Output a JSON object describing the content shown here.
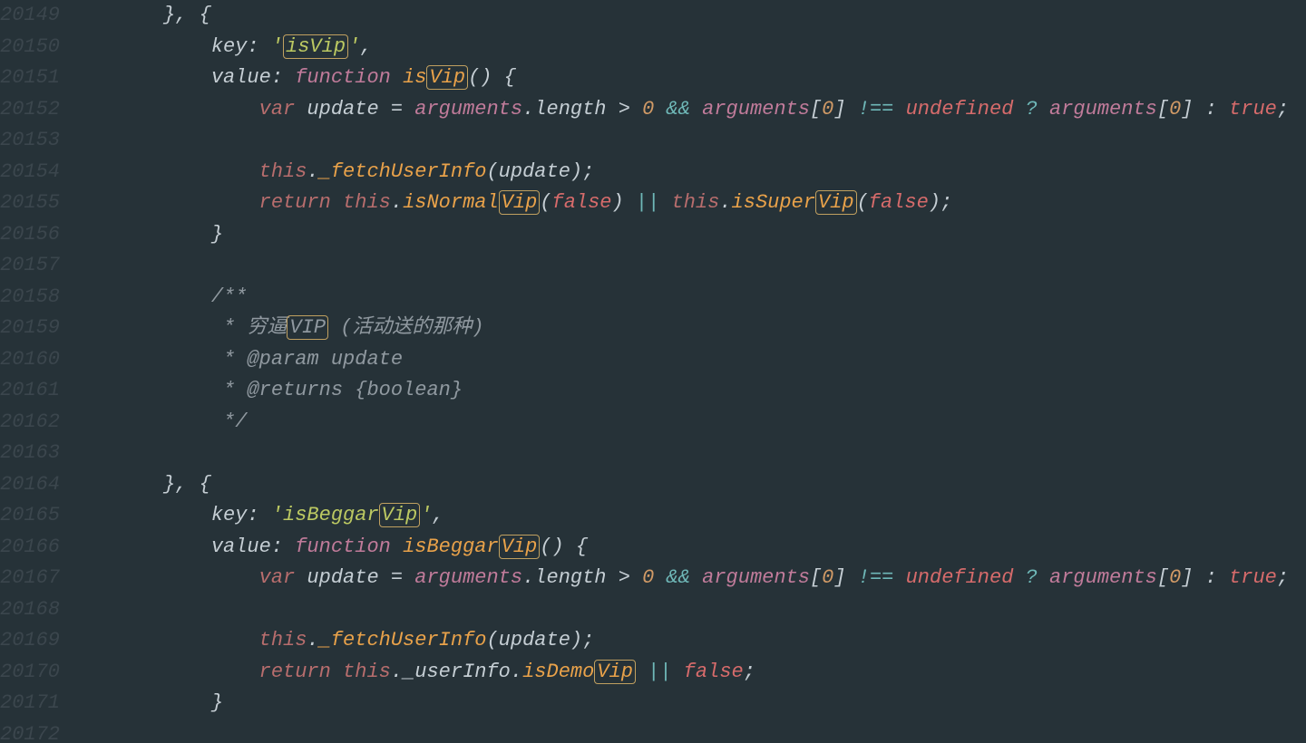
{
  "startLine": 20149,
  "lines": [
    {
      "indent": 0,
      "segs": [
        {
          "t": "}, {",
          "c": ""
        }
      ]
    },
    {
      "indent": 1,
      "segs": [
        {
          "t": "key: ",
          "c": ""
        },
        {
          "t": "'",
          "c": "str"
        },
        {
          "t": "isVip",
          "c": "str box"
        },
        {
          "t": "'",
          "c": "str"
        },
        {
          "t": ",",
          "c": ""
        }
      ]
    },
    {
      "indent": 1,
      "segs": [
        {
          "t": "value: ",
          "c": ""
        },
        {
          "t": "function",
          "c": "ft"
        },
        {
          "t": " ",
          "c": ""
        },
        {
          "t": "is",
          "c": "fn"
        },
        {
          "t": "Vip",
          "c": "fn box"
        },
        {
          "t": "() {",
          "c": ""
        }
      ]
    },
    {
      "indent": 2,
      "segs": [
        {
          "t": "var",
          "c": "kw"
        },
        {
          "t": " update = ",
          "c": ""
        },
        {
          "t": "arguments",
          "c": "arg"
        },
        {
          "t": ".length > ",
          "c": ""
        },
        {
          "t": "0",
          "c": "num"
        },
        {
          "t": " ",
          "c": ""
        },
        {
          "t": "&&",
          "c": "op"
        },
        {
          "t": " ",
          "c": ""
        },
        {
          "t": "arguments",
          "c": "arg"
        },
        {
          "t": "[",
          "c": ""
        },
        {
          "t": "0",
          "c": "num"
        },
        {
          "t": "] ",
          "c": ""
        },
        {
          "t": "!==",
          "c": "op"
        },
        {
          "t": " ",
          "c": ""
        },
        {
          "t": "undefined",
          "c": "bl"
        },
        {
          "t": " ",
          "c": ""
        },
        {
          "t": "?",
          "c": "op"
        },
        {
          "t": " ",
          "c": ""
        },
        {
          "t": "arguments",
          "c": "arg"
        },
        {
          "t": "[",
          "c": ""
        },
        {
          "t": "0",
          "c": "num"
        },
        {
          "t": "] : ",
          "c": ""
        },
        {
          "t": "true",
          "c": "bl"
        },
        {
          "t": ";",
          "c": ""
        }
      ]
    },
    {
      "indent": 2,
      "segs": []
    },
    {
      "indent": 2,
      "segs": [
        {
          "t": "this",
          "c": "kw"
        },
        {
          "t": ".",
          "c": ""
        },
        {
          "t": "_fetchUserInfo",
          "c": "fn"
        },
        {
          "t": "(update);",
          "c": ""
        }
      ]
    },
    {
      "indent": 2,
      "segs": [
        {
          "t": "return",
          "c": "kw"
        },
        {
          "t": " ",
          "c": ""
        },
        {
          "t": "this",
          "c": "kw"
        },
        {
          "t": ".",
          "c": ""
        },
        {
          "t": "isNormal",
          "c": "fn"
        },
        {
          "t": "Vip",
          "c": "fn box"
        },
        {
          "t": "(",
          "c": ""
        },
        {
          "t": "false",
          "c": "bl"
        },
        {
          "t": ") ",
          "c": ""
        },
        {
          "t": "||",
          "c": "op"
        },
        {
          "t": " ",
          "c": ""
        },
        {
          "t": "this",
          "c": "kw"
        },
        {
          "t": ".",
          "c": ""
        },
        {
          "t": "isSuper",
          "c": "fn"
        },
        {
          "t": "Vip",
          "c": "fn box"
        },
        {
          "t": "(",
          "c": ""
        },
        {
          "t": "false",
          "c": "bl"
        },
        {
          "t": ");",
          "c": ""
        }
      ]
    },
    {
      "indent": 1,
      "segs": [
        {
          "t": "}",
          "c": ""
        }
      ]
    },
    {
      "indent": 1,
      "segs": []
    },
    {
      "indent": 1,
      "segs": [
        {
          "t": "/**",
          "c": "com"
        }
      ]
    },
    {
      "indent": 1,
      "segs": [
        {
          "t": " * 穷逼",
          "c": "com"
        },
        {
          "t": "VIP",
          "c": "com box"
        },
        {
          "t": " (活动送的那种)",
          "c": "com"
        }
      ]
    },
    {
      "indent": 1,
      "segs": [
        {
          "t": " * ",
          "c": "com"
        },
        {
          "t": "@param",
          "c": "comi"
        },
        {
          "t": " update",
          "c": "com"
        }
      ]
    },
    {
      "indent": 1,
      "segs": [
        {
          "t": " * ",
          "c": "com"
        },
        {
          "t": "@returns",
          "c": "comi"
        },
        {
          "t": " {boolean}",
          "c": "com"
        }
      ]
    },
    {
      "indent": 1,
      "segs": [
        {
          "t": " */",
          "c": "com"
        }
      ]
    },
    {
      "indent": 1,
      "segs": []
    },
    {
      "indent": 0,
      "segs": [
        {
          "t": "}, {",
          "c": ""
        }
      ]
    },
    {
      "indent": 1,
      "segs": [
        {
          "t": "key: ",
          "c": ""
        },
        {
          "t": "'",
          "c": "str"
        },
        {
          "t": "isBeggar",
          "c": "str"
        },
        {
          "t": "Vip",
          "c": "str box"
        },
        {
          "t": "'",
          "c": "str"
        },
        {
          "t": ",",
          "c": ""
        }
      ]
    },
    {
      "indent": 1,
      "segs": [
        {
          "t": "value: ",
          "c": ""
        },
        {
          "t": "function",
          "c": "ft"
        },
        {
          "t": " ",
          "c": ""
        },
        {
          "t": "isBeggar",
          "c": "fn"
        },
        {
          "t": "Vip",
          "c": "fn box"
        },
        {
          "t": "() {",
          "c": ""
        }
      ]
    },
    {
      "indent": 2,
      "segs": [
        {
          "t": "var",
          "c": "kw"
        },
        {
          "t": " update = ",
          "c": ""
        },
        {
          "t": "arguments",
          "c": "arg"
        },
        {
          "t": ".length > ",
          "c": ""
        },
        {
          "t": "0",
          "c": "num"
        },
        {
          "t": " ",
          "c": ""
        },
        {
          "t": "&&",
          "c": "op"
        },
        {
          "t": " ",
          "c": ""
        },
        {
          "t": "arguments",
          "c": "arg"
        },
        {
          "t": "[",
          "c": ""
        },
        {
          "t": "0",
          "c": "num"
        },
        {
          "t": "] ",
          "c": ""
        },
        {
          "t": "!==",
          "c": "op"
        },
        {
          "t": " ",
          "c": ""
        },
        {
          "t": "undefined",
          "c": "bl"
        },
        {
          "t": " ",
          "c": ""
        },
        {
          "t": "?",
          "c": "op"
        },
        {
          "t": " ",
          "c": ""
        },
        {
          "t": "arguments",
          "c": "arg"
        },
        {
          "t": "[",
          "c": ""
        },
        {
          "t": "0",
          "c": "num"
        },
        {
          "t": "] : ",
          "c": ""
        },
        {
          "t": "true",
          "c": "bl"
        },
        {
          "t": ";",
          "c": ""
        }
      ]
    },
    {
      "indent": 2,
      "segs": []
    },
    {
      "indent": 2,
      "segs": [
        {
          "t": "this",
          "c": "kw"
        },
        {
          "t": ".",
          "c": ""
        },
        {
          "t": "_fetchUserInfo",
          "c": "fn"
        },
        {
          "t": "(update);",
          "c": ""
        }
      ]
    },
    {
      "indent": 2,
      "segs": [
        {
          "t": "return",
          "c": "kw"
        },
        {
          "t": " ",
          "c": ""
        },
        {
          "t": "this",
          "c": "kw"
        },
        {
          "t": ".",
          "c": ""
        },
        {
          "t": "_userInfo",
          "c": ""
        },
        {
          "t": ".",
          "c": ""
        },
        {
          "t": "isDemo",
          "c": "fn"
        },
        {
          "t": "Vip",
          "c": "fn box"
        },
        {
          "t": " ",
          "c": ""
        },
        {
          "t": "||",
          "c": "op"
        },
        {
          "t": " ",
          "c": ""
        },
        {
          "t": "false",
          "c": "bl"
        },
        {
          "t": ";",
          "c": ""
        }
      ]
    },
    {
      "indent": 1,
      "segs": [
        {
          "t": "}",
          "c": ""
        }
      ]
    },
    {
      "indent": 1,
      "segs": []
    }
  ]
}
